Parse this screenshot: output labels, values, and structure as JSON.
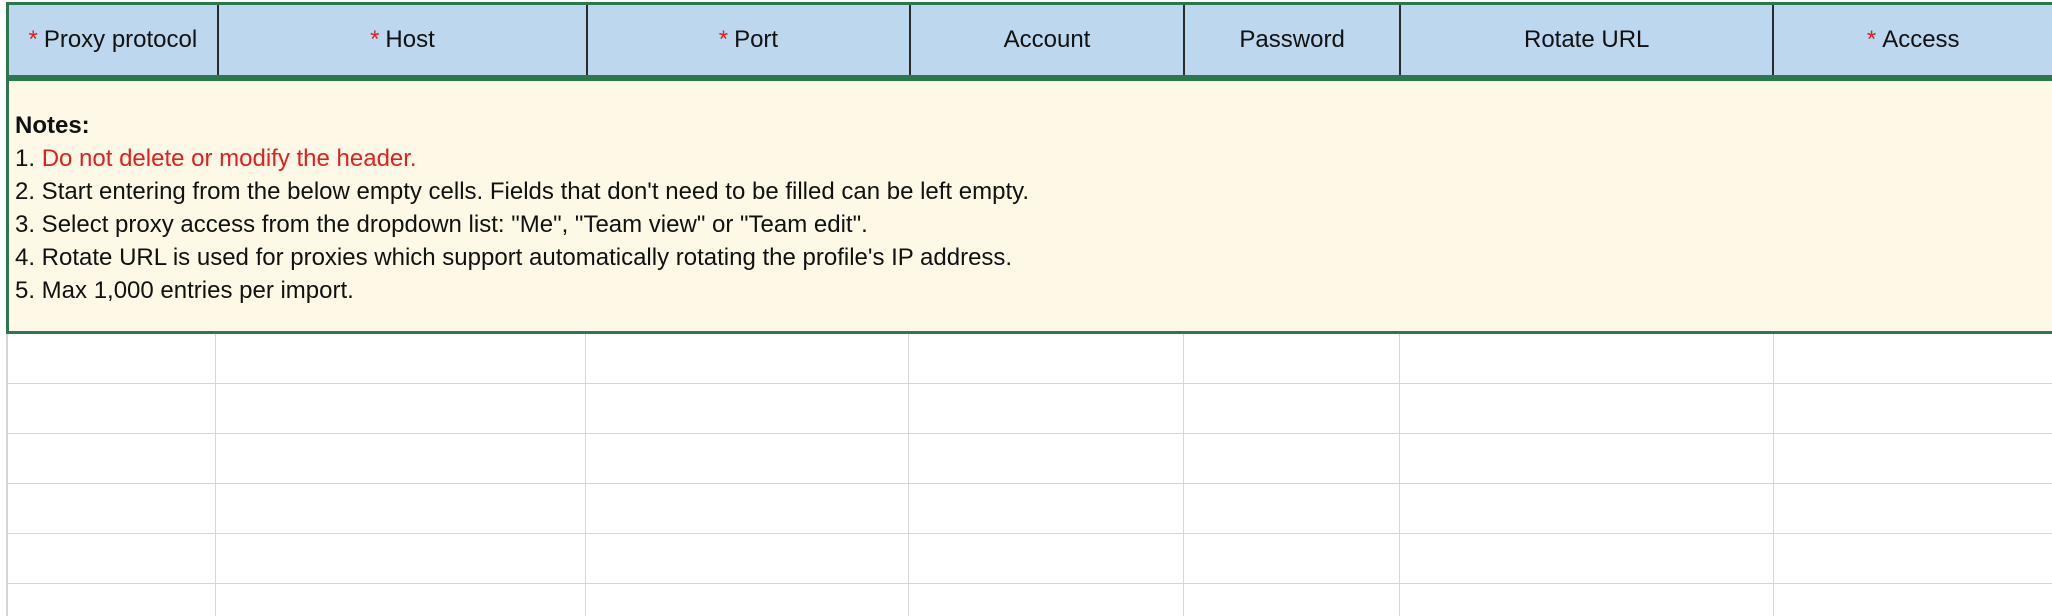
{
  "sheet": {
    "columns": [
      {
        "label": "Proxy protocol",
        "required": true,
        "width": 210
      },
      {
        "label": "Host",
        "required": true,
        "width": 370
      },
      {
        "label": "Port",
        "required": true,
        "width": 323
      },
      {
        "label": "Account",
        "required": false,
        "width": 275
      },
      {
        "label": "Password",
        "required": false,
        "width": 216
      },
      {
        "label": "Rotate URL",
        "required": false,
        "width": 374
      },
      {
        "label": "Access",
        "required": true,
        "width": 278
      }
    ],
    "required_marker": "*"
  },
  "notes": {
    "title": "Notes:",
    "line1_prefix": "1. ",
    "line1_text": "Do not delete or modify the header.",
    "line2": "2. Start entering from the below empty cells. Fields that don't need to be filled can be left empty.",
    "line3": "3. Select proxy access from the dropdown list: \"Me\", \"Team view\" or \"Team edit\".",
    "line4": "4. Rotate URL is used for proxies which support automatically rotating the profile's IP address.",
    "line5": "5. Max 1,000 entries per import."
  },
  "colors": {
    "header_bg": "#bdd7ee",
    "notes_bg": "#fef8e6",
    "border_green": "#2e7650",
    "required_red": "#e0201c"
  }
}
